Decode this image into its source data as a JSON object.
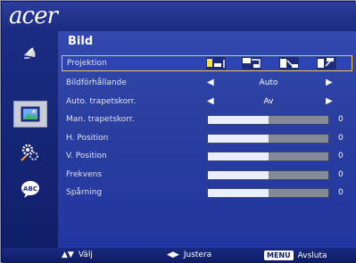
{
  "brand": "acer",
  "menu": {
    "title": "Bild",
    "items": [
      {
        "label": "Projektion",
        "kind": "icons",
        "selected": true
      },
      {
        "label": "Bildförhållande",
        "kind": "select",
        "value": "Auto"
      },
      {
        "label": "Auto. trapetskorr.",
        "kind": "select",
        "value": "Av"
      },
      {
        "label": "Man. trapetskorr.",
        "kind": "slider",
        "value": "0",
        "level": 0.5
      },
      {
        "label": "H. Position",
        "kind": "slider",
        "value": "0",
        "level": 0.5
      },
      {
        "label": "V. Position",
        "kind": "slider",
        "value": "0",
        "level": 0.5
      },
      {
        "label": "Frekvens",
        "kind": "slider",
        "value": "0",
        "level": 0.5
      },
      {
        "label": "Spårning",
        "kind": "slider",
        "value": "0",
        "level": 0.5
      }
    ]
  },
  "projection_icons": [
    "front-desk-icon",
    "rear-desk-icon",
    "front-ceiling-icon",
    "rear-ceiling-icon"
  ],
  "sidebar": {
    "icons": [
      "satellite-dish-icon",
      "picture-icon",
      "gears-icon",
      "language-icon"
    ],
    "language_text": "ABC",
    "active_index": 1
  },
  "footer": {
    "select_label": "Välj",
    "adjust_label": "Justera",
    "menu_key": "MENU",
    "exit_label": "Avsluta"
  },
  "colors": {
    "highlight_border": "#f2c84a",
    "panel": "#2a3f9f",
    "bar_fill": "#e9eef8",
    "bar_empty": "#858a98"
  }
}
